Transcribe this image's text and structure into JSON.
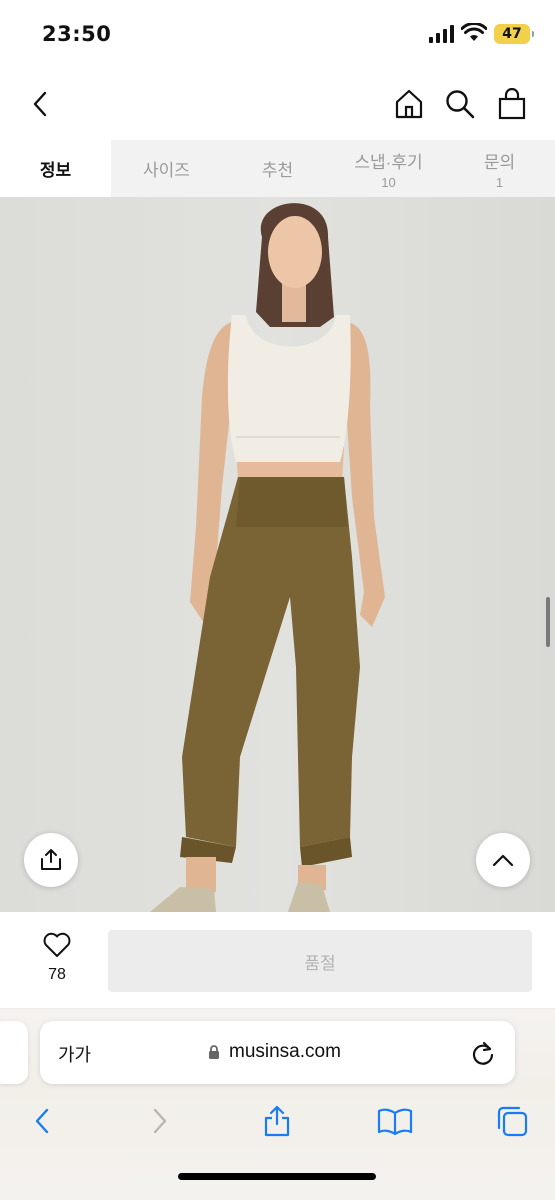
{
  "status_bar": {
    "time": "23:50",
    "battery": "47"
  },
  "tabs": [
    {
      "label": "정보",
      "count": ""
    },
    {
      "label": "사이즈",
      "count": ""
    },
    {
      "label": "추천",
      "count": ""
    },
    {
      "label": "스냅·후기",
      "count": "10"
    },
    {
      "label": "문의",
      "count": "1"
    }
  ],
  "actions": {
    "like_count": "78",
    "buy_button": "품절"
  },
  "browser": {
    "text_size_label": "가가",
    "url": "musinsa.com"
  },
  "colors": {
    "accent_icon": "#1a7cf5",
    "pants": "#7a6334",
    "top": "#f1ede5"
  }
}
